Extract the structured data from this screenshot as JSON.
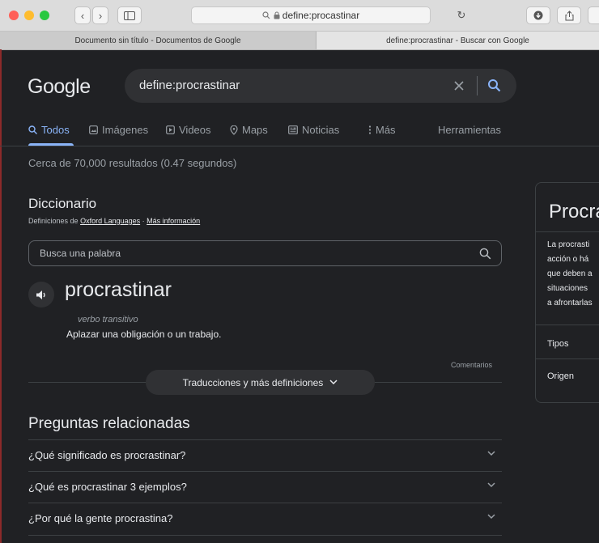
{
  "browser": {
    "url": "define:procastinar",
    "tabs": [
      {
        "label": "Documento sin título - Documentos de Google",
        "active": false
      },
      {
        "label": "define:procrastinar - Buscar con Google",
        "active": true
      }
    ]
  },
  "google": {
    "logo": "Google",
    "query": "define:procrastinar",
    "nav": [
      {
        "label": "Todos",
        "icon": "search-icon",
        "active": true
      },
      {
        "label": "Imágenes",
        "icon": "image-icon",
        "active": false
      },
      {
        "label": "Videos",
        "icon": "video-icon",
        "active": false
      },
      {
        "label": "Maps",
        "icon": "map-pin-icon",
        "active": false
      },
      {
        "label": "Noticias",
        "icon": "news-icon",
        "active": false
      },
      {
        "label": "Más",
        "icon": "more-vert-icon",
        "active": false
      }
    ],
    "tools": "Herramientas",
    "stats": "Cerca de 70,000 resultados (0.47 segundos)"
  },
  "dictionary": {
    "title": "Diccionario",
    "source_prefix": "Definiciones de",
    "source_link": "Oxford Languages",
    "source_sep": "·",
    "more_info": "Más información",
    "search_placeholder": "Busca una palabra",
    "word": "procrastinar",
    "part_of_speech": "verbo transitivo",
    "definition": "Aplazar una obligación o un trabajo.",
    "feedback": "Comentarios",
    "more_button": "Traducciones y más definiciones"
  },
  "related": {
    "title": "Preguntas relacionadas",
    "questions": [
      "¿Qué significado es procrastinar?",
      "¿Qué es procrastinar 3 ejemplos?",
      "¿Por qué la gente procrastina?"
    ]
  },
  "knowledge_panel": {
    "title": "Procra",
    "lines": [
      "La procrasti",
      "acción o há",
      "que deben a",
      "situaciones",
      "a afrontarlas"
    ],
    "rows": [
      "Tipos",
      "Origen"
    ]
  },
  "colors": {
    "background": "#202124",
    "accent": "#8ab4f8",
    "text": "#e8eaed",
    "muted": "#9aa0a6"
  }
}
